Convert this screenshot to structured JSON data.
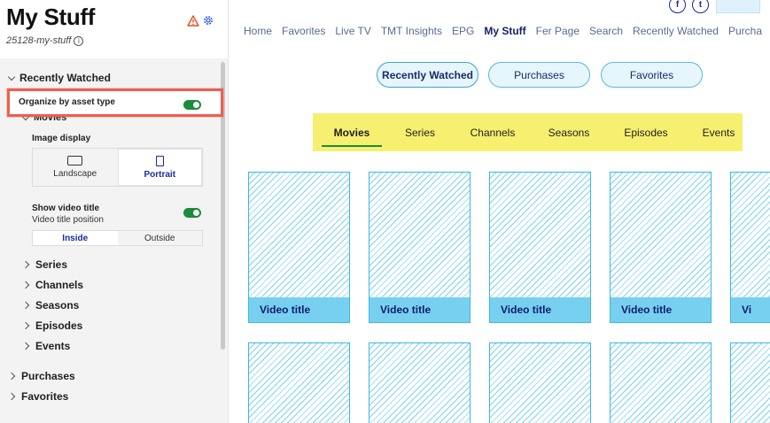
{
  "sidebar": {
    "title": "My Stuff",
    "page_id": "25128-my-stuff",
    "sections": {
      "recently_watched": "Recently Watched",
      "organize_label": "Organize by asset type",
      "movies": "Movies",
      "image_display_label": "Image display",
      "landscape": "Landscape",
      "portrait": "Portrait",
      "show_video_title": "Show video title",
      "video_title_position": "Video title position",
      "inside": "Inside",
      "outside": "Outside",
      "series": "Series",
      "channels": "Channels",
      "seasons": "Seasons",
      "episodes": "Episodes",
      "events": "Events",
      "purchases": "Purchases",
      "favorites": "Favorites"
    },
    "toggles": {
      "organize_by_asset_type": true,
      "show_video_title": true
    },
    "image_display_selected": "Portrait",
    "title_position_selected": "Inside"
  },
  "main": {
    "nav": [
      "Home",
      "Favorites",
      "Live TV",
      "TMT Insights",
      "EPG",
      "My Stuff",
      "Fer Page",
      "Search",
      "Recently Watched",
      "Purcha"
    ],
    "nav_active": "My Stuff",
    "pills": [
      "Recently Watched",
      "Purchases",
      "Favorites"
    ],
    "pill_active": "Recently Watched",
    "type_tabs": [
      "Movies",
      "Series",
      "Channels",
      "Seasons",
      "Episodes",
      "Events"
    ],
    "type_tab_active": "Movies",
    "card_title": "Video title",
    "card_title_cut": "Vi"
  },
  "colors": {
    "accent_navy": "#1a2a9c",
    "toggle_on": "#1a8c3b",
    "highlight_border": "#ee5f4f",
    "type_bar": "#f7ef70",
    "card_stripe": "#7fd3ef"
  },
  "icons": {
    "warning": "warning-triangle-icon",
    "settings": "gear-icon",
    "info": "info-icon",
    "facebook": "facebook-icon",
    "twitter": "twitter-icon"
  }
}
